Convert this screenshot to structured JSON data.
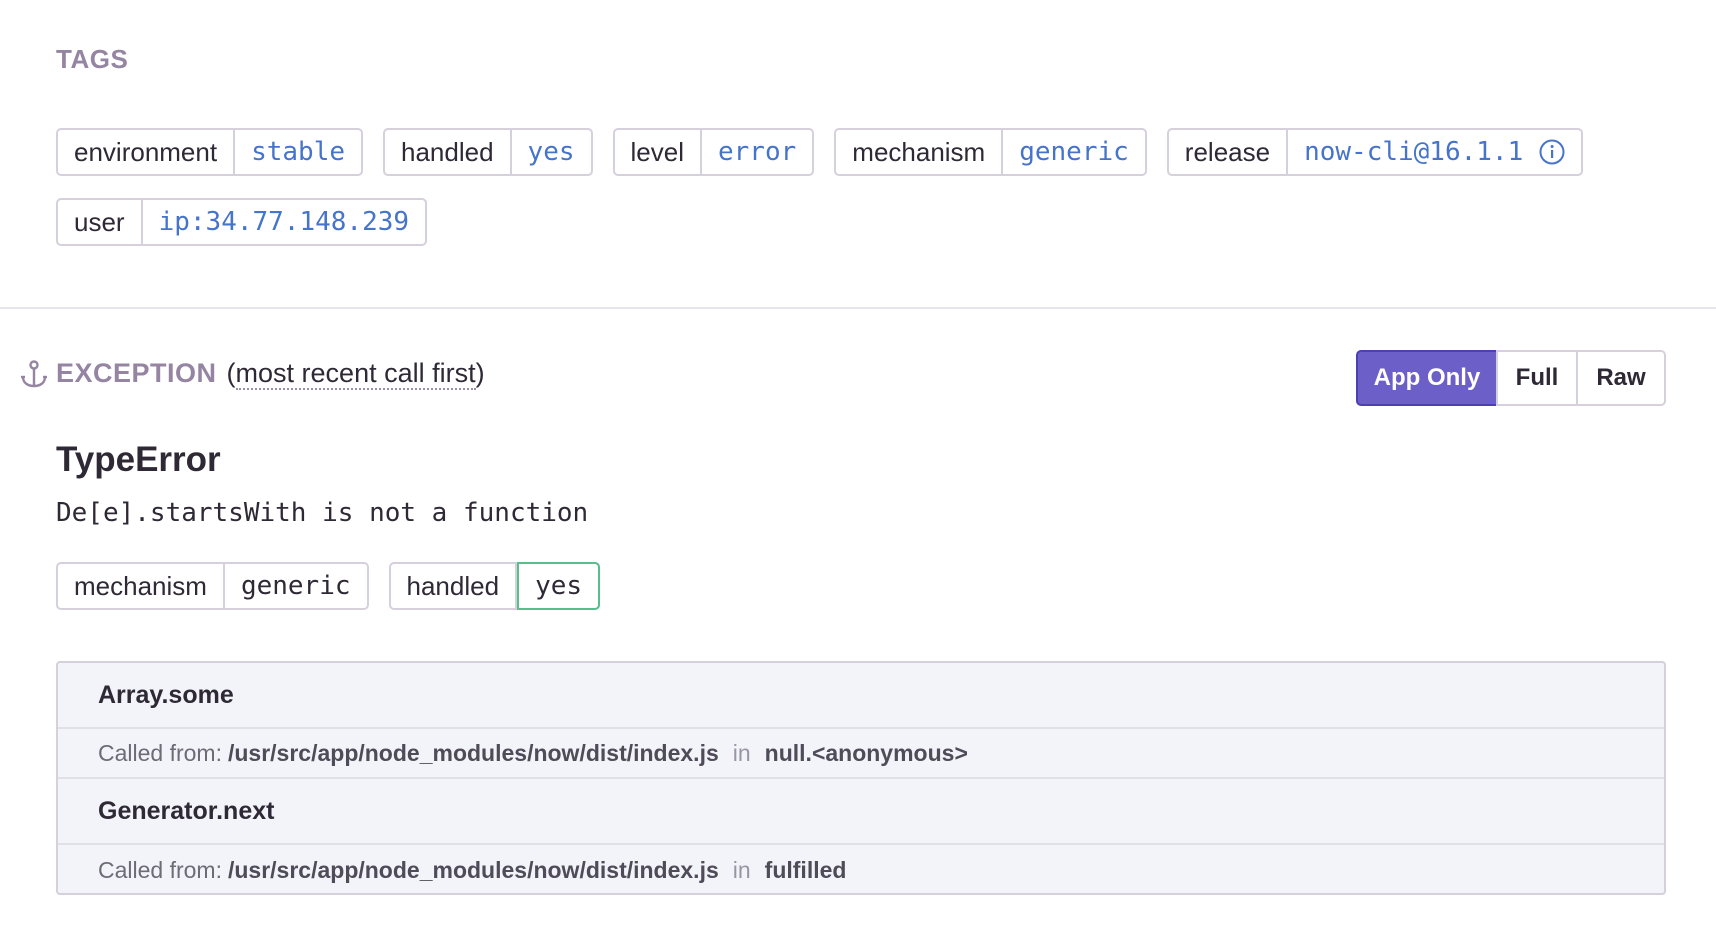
{
  "tags": {
    "heading": "TAGS",
    "items": [
      {
        "key": "environment",
        "value": "stable"
      },
      {
        "key": "handled",
        "value": "yes"
      },
      {
        "key": "level",
        "value": "error"
      },
      {
        "key": "mechanism",
        "value": "generic"
      },
      {
        "key": "release",
        "value": "now-cli@16.1.1"
      },
      {
        "key": "user",
        "value": "ip:34.77.148.239"
      }
    ]
  },
  "exception": {
    "title": "EXCEPTION",
    "subtitle_open": "(",
    "subtitle": "most recent call first",
    "subtitle_close": ")",
    "view_buttons": [
      "App Only",
      "Full",
      "Raw"
    ],
    "active_view": "App Only",
    "type": "TypeError",
    "message": "De[e].startsWith is not a function",
    "mechanism_tags": [
      {
        "key": "mechanism",
        "value": "generic"
      },
      {
        "key": "handled",
        "value": "yes"
      }
    ],
    "frames": [
      {
        "function": "Array.some",
        "called_from_label": "Called from:",
        "path": "/usr/src/app/node_modules/now/dist/index.js",
        "in_label": "in",
        "caller": "null.<anonymous>"
      },
      {
        "function": "Generator.next",
        "called_from_label": "Called from:",
        "path": "/usr/src/app/node_modules/now/dist/index.js",
        "in_label": "in",
        "caller": "fulfilled"
      }
    ]
  },
  "colors": {
    "accent": "#6c5fc7",
    "tag_value": "#4674ca",
    "heading": "#9585a3",
    "handled_border": "#57be8c"
  },
  "icons": [
    "info-icon",
    "anchor-icon"
  ]
}
